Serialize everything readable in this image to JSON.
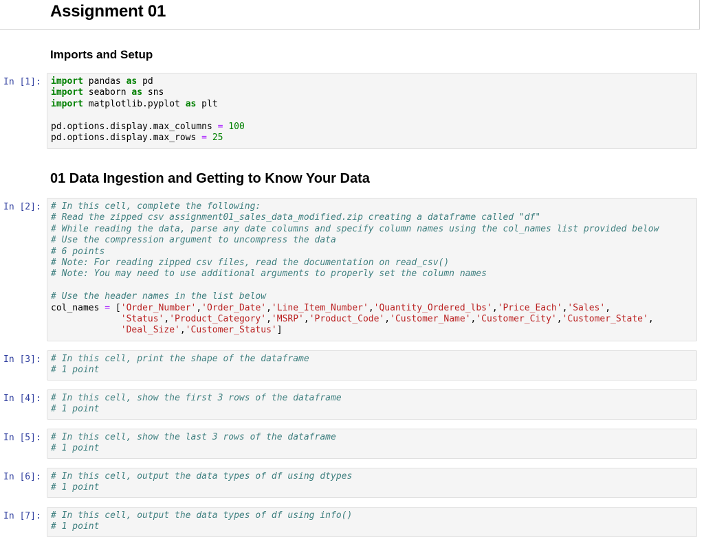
{
  "notebook": {
    "title": "Assignment 01",
    "section_imports": "Imports and Setup",
    "section_ingestion": "01 Data Ingestion and Getting to Know Your Data"
  },
  "cells": [
    {
      "prompt": "In [1]:",
      "lines": [
        "import pandas as pd",
        "import seaborn as sns",
        "import matplotlib.pyplot as plt",
        "",
        "pd.options.display.max_columns = 100",
        "pd.options.display.max_rows = 25"
      ]
    },
    {
      "prompt": "In [2]:",
      "lines": [
        "# In this cell, complete the following:",
        "# Read the zipped csv assignment01_sales_data_modified.zip creating a dataframe called \"df\"",
        "# While reading the data, parse any date columns and specify column names using the col_names list provided below",
        "# Use the compression argument to uncompress the data",
        "# 6 points",
        "# Note: For reading zipped csv files, read the documentation on read_csv()",
        "# Note: You may need to use additional arguments to properly set the column names",
        "",
        "# Use the header names in the list below",
        "col_names = ['Order_Number','Order_Date','Line_Item_Number','Quantity_Ordered_lbs','Price_Each','Sales',",
        "             'Status','Product_Category','MSRP','Product_Code','Customer_Name','Customer_City','Customer_State',",
        "             'Deal_Size','Customer_Status']"
      ]
    },
    {
      "prompt": "In [3]:",
      "lines": [
        "# In this cell, print the shape of the dataframe",
        "# 1 point"
      ]
    },
    {
      "prompt": "In [4]:",
      "lines": [
        "# In this cell, show the first 3 rows of the dataframe",
        "# 1 point"
      ]
    },
    {
      "prompt": "In [5]:",
      "lines": [
        "# In this cell, show the last 3 rows of the dataframe",
        "# 1 point"
      ]
    },
    {
      "prompt": "In [6]:",
      "lines": [
        "# In this cell, output the data types of df using dtypes",
        "# 1 point"
      ]
    },
    {
      "prompt": "In [7]:",
      "lines": [
        "# In this cell, output the data types of df using info()",
        "# 1 point"
      ]
    }
  ]
}
